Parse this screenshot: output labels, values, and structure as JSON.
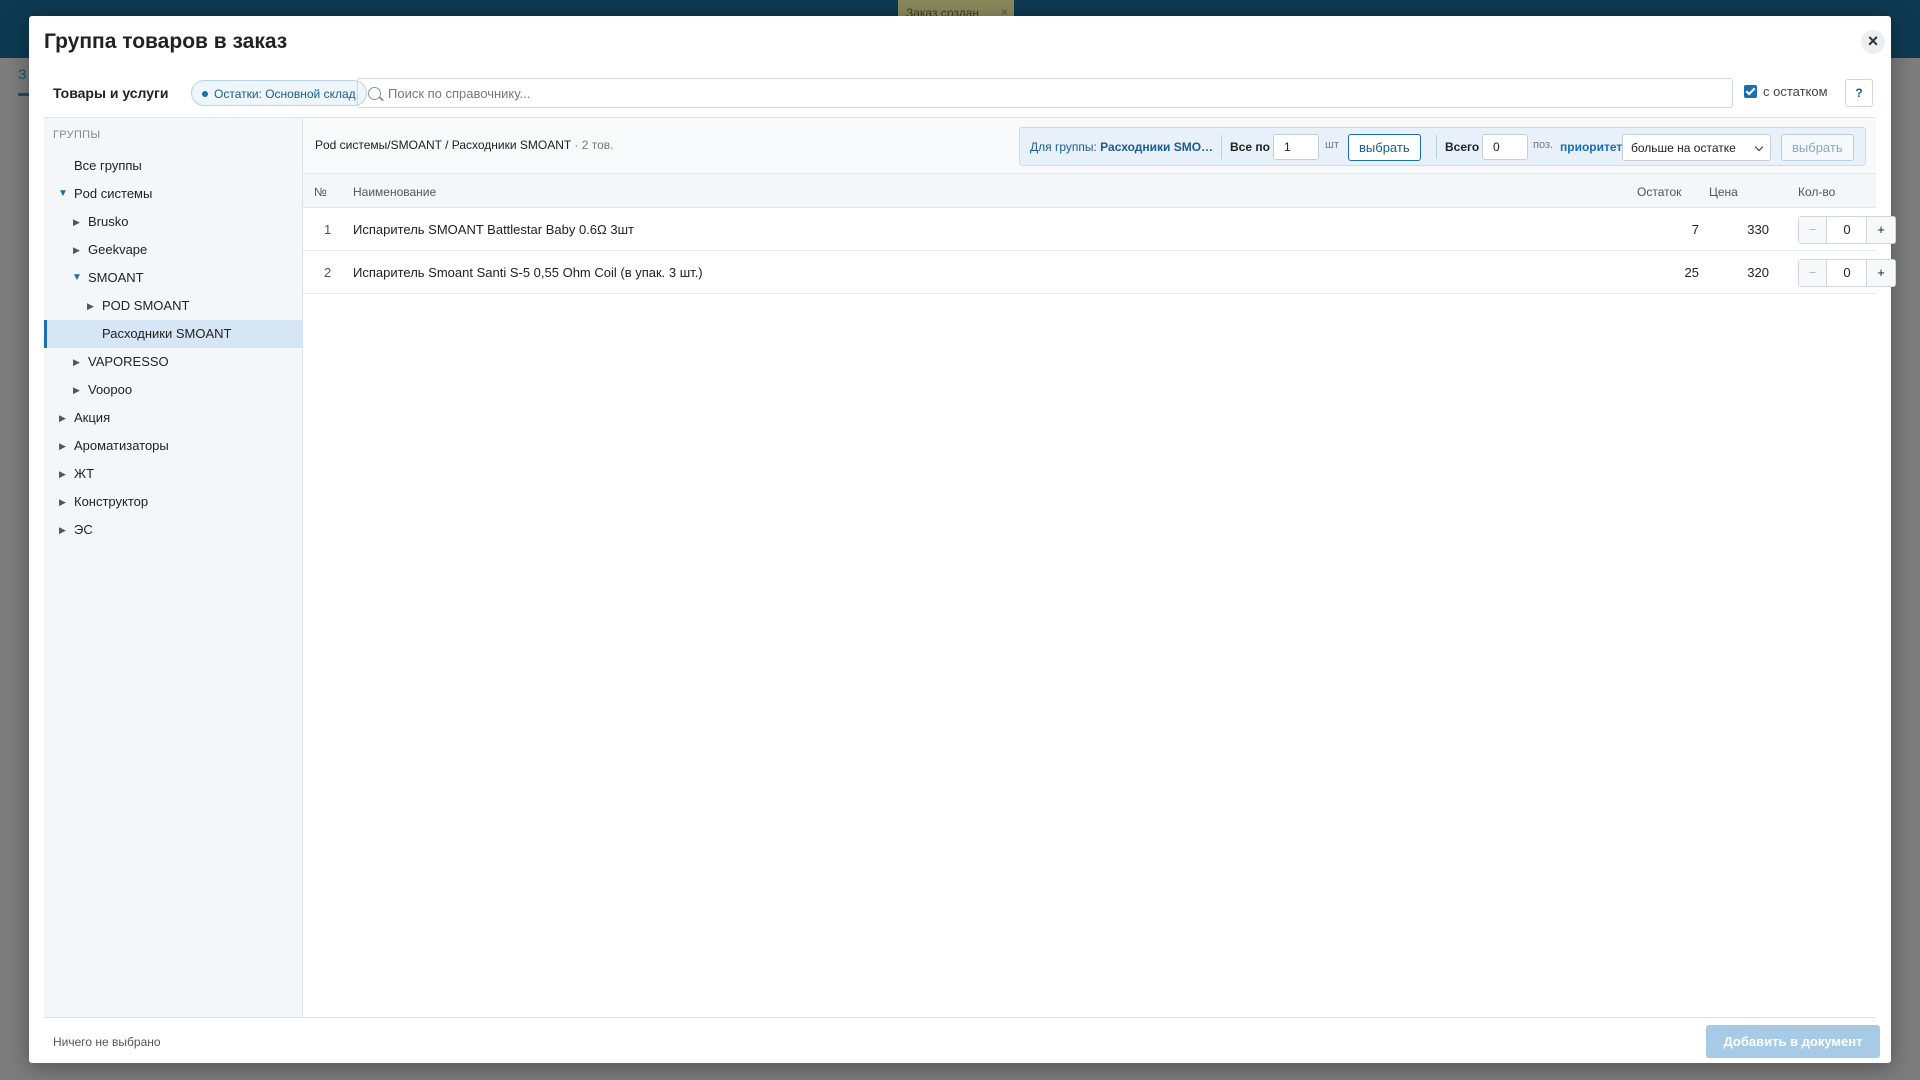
{
  "background": {
    "toast": "Заказ создан",
    "tab_letter": "З"
  },
  "modal": {
    "title": "Группа товаров в заказ",
    "close_icon": "close-icon"
  },
  "toolbar": {
    "label": "Товары и услуги",
    "stock_pill": "Остатки: Основной склад",
    "search_placeholder": "Поиск по справочнику...",
    "with_stock_label": "с остатком",
    "with_stock_checked": true,
    "help_label": "?"
  },
  "sidebar": {
    "heading": "ГРУППЫ",
    "items": [
      {
        "label": "Все группы",
        "arrow": ""
      },
      {
        "label": "Pod системы",
        "arrow": "▼"
      },
      {
        "label": "Brusko",
        "arrow": "▶"
      },
      {
        "label": "Geekvape",
        "arrow": "▶"
      },
      {
        "label": "SMOANT",
        "arrow": "▼"
      },
      {
        "label": "POD SMOANT",
        "arrow": "▶"
      },
      {
        "label": "Расходники SMOANT",
        "arrow": "",
        "active": true
      },
      {
        "label": "VAPORESSO",
        "arrow": "▶"
      },
      {
        "label": "Voopoo",
        "arrow": "▶"
      },
      {
        "label": "Акция",
        "arrow": "▶"
      },
      {
        "label": "Ароматизаторы",
        "arrow": "▶"
      },
      {
        "label": "ЖТ",
        "arrow": "▶"
      },
      {
        "label": "Конструктор",
        "arrow": "▶"
      },
      {
        "label": "ЭС",
        "arrow": "▶"
      }
    ]
  },
  "main": {
    "breadcrumb": "Pod системы/SMOANT / Расходники SMOANT",
    "breadcrumb_count": " · 2 тов.",
    "group_panel": {
      "for_group_prefix": "Для группы: ",
      "for_group_name": "Расходники SMO…",
      "all_by_label": "Все по",
      "all_by_value": "1",
      "unit": "шт",
      "select_button": "выбрать",
      "total_label": "Всего",
      "total_value": "0",
      "total_unit": "поз.",
      "priority_label": "приоритет",
      "priority_value": "больше на остатке",
      "select_button_disabled": "выбрать"
    },
    "columns": {
      "num": "№",
      "name": "Наименование",
      "stock": "Остаток",
      "price": "Цена",
      "qty": "Кол-во"
    },
    "rows": [
      {
        "num": "1",
        "name": "Испаритель SMOANT Battlestar Baby 0.6Ω 3шт",
        "stock": "7",
        "price": "330",
        "qty": "0"
      },
      {
        "num": "2",
        "name": "Испаритель Smoant Santi S-5 0,55 Ohm Coil (в упак. 3 шт.)",
        "stock": "25",
        "price": "320",
        "qty": "0"
      }
    ]
  },
  "footer": {
    "status": "Ничего не выбрано",
    "add_button": "Добавить в документ"
  },
  "colors": {
    "accent": "#1a6fb0",
    "header_bg": "#0d3a52",
    "active_row": "#d6e6f5",
    "add_button_disabled": "#a7cbe6"
  }
}
